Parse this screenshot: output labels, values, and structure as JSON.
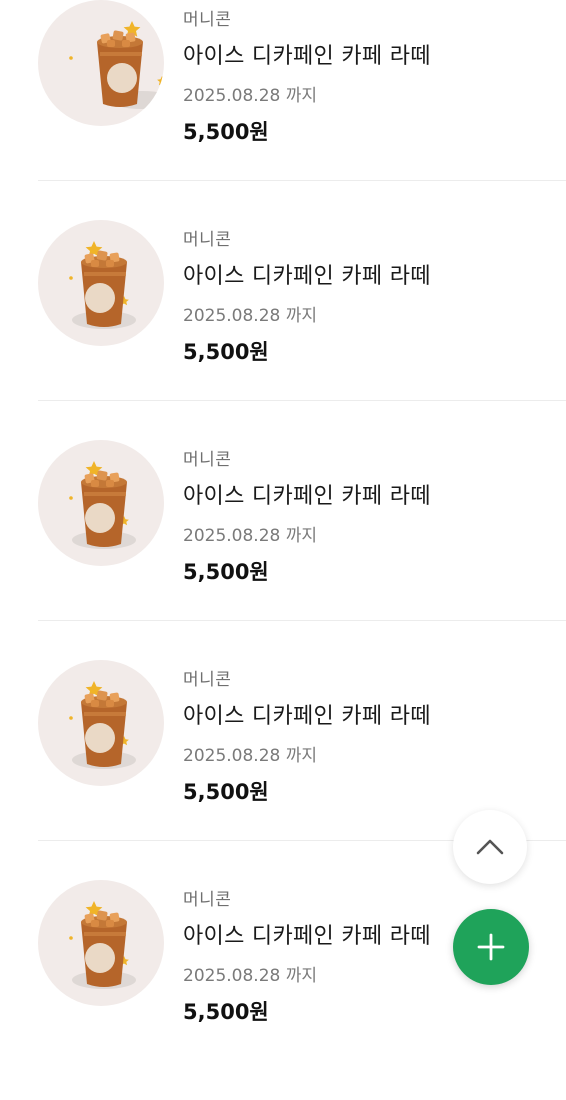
{
  "items": [
    {
      "brand": "머니콘",
      "name": "아이스 디카페인 카페 라떼",
      "expiry": "2025.08.28 까지",
      "price": "5,500원",
      "image_icon": "iced-coffee-cup-icon"
    },
    {
      "brand": "머니콘",
      "name": "아이스 디카페인 카페 라떼",
      "expiry": "2025.08.28 까지",
      "price": "5,500원",
      "image_icon": "iced-coffee-cup-icon"
    },
    {
      "brand": "머니콘",
      "name": "아이스 디카페인 카페 라떼",
      "expiry": "2025.08.28 까지",
      "price": "5,500원",
      "image_icon": "iced-coffee-cup-icon"
    },
    {
      "brand": "머니콘",
      "name": "아이스 디카페인 카페 라떼",
      "expiry": "2025.08.28 까지",
      "price": "5,500원",
      "image_icon": "iced-coffee-cup-icon"
    },
    {
      "brand": "머니콘",
      "name": "아이스 디카페인 카페 라떼",
      "expiry": "2025.08.28 까지",
      "price": "5,500원",
      "image_icon": "iced-coffee-cup-icon"
    }
  ],
  "scroll_top_button": {
    "icon": "chevron-up-icon"
  },
  "add_button": {
    "icon": "plus-icon",
    "color": "#1fa35a"
  },
  "colors": {
    "thumb_bg": "#f2ebe9",
    "cup": "#b5652a",
    "star": "#f0b429"
  }
}
